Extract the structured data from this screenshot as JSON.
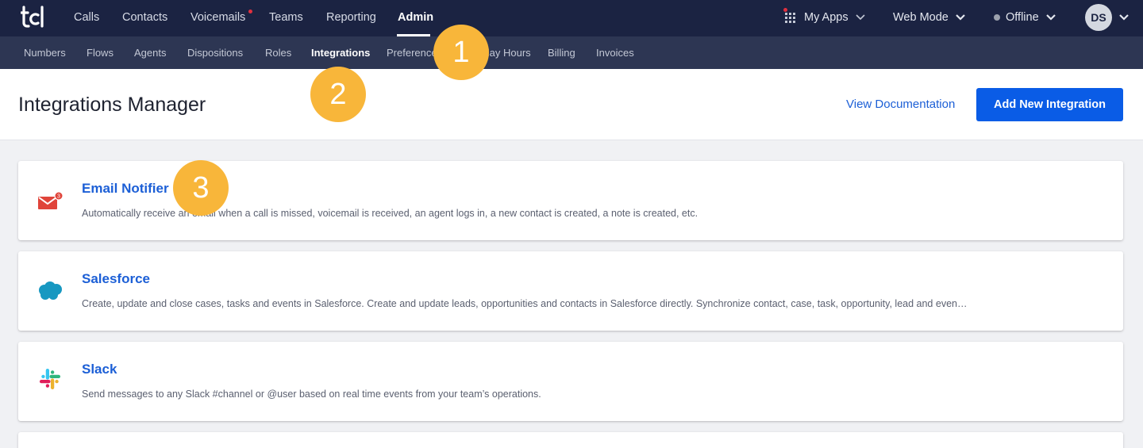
{
  "logo": "tcl",
  "top_nav": {
    "items": [
      {
        "label": "Calls"
      },
      {
        "label": "Contacts"
      },
      {
        "label": "Voicemails"
      },
      {
        "label": "Teams"
      },
      {
        "label": "Reporting"
      },
      {
        "label": "Admin",
        "active": true
      }
    ],
    "right": {
      "my_apps": "My Apps",
      "web_mode": "Web Mode",
      "status": "Offline",
      "avatar_initials": "DS"
    }
  },
  "sub_nav": {
    "items": [
      {
        "label": "Numbers"
      },
      {
        "label": "Flows"
      },
      {
        "label": "Agents"
      },
      {
        "label": "Dispositions"
      },
      {
        "label": "Roles"
      },
      {
        "label": "Integrations",
        "active": true
      },
      {
        "label": "Preferences"
      },
      {
        "label": "Holiday Hours"
      },
      {
        "label": "Billing"
      },
      {
        "label": "Invoices"
      }
    ]
  },
  "header": {
    "title": "Integrations Manager",
    "doc_link": "View Documentation",
    "add_button": "Add New Integration"
  },
  "integrations": [
    {
      "name": "Email Notifier",
      "description": "Automatically receive an email when a call is missed, voicemail is received, an agent logs in, a new contact is created, a note is created, etc.",
      "icon": "email-notifier-icon"
    },
    {
      "name": "Salesforce",
      "description": "Create, update and close cases, tasks and events in Salesforce. Create and update leads, opportunities and contacts in Salesforce directly. Synchronize contact, case, task, opportunity, lead and even…",
      "icon": "salesforce-icon"
    },
    {
      "name": "Slack",
      "description": "Send messages to any Slack #channel or @user based on real time events from your team’s operations.",
      "icon": "slack-icon"
    }
  ],
  "step_badges": [
    "1",
    "2",
    "3"
  ],
  "colors": {
    "topbar": "#1b2342",
    "subbar": "#2d3653",
    "accent_blue": "#0a5ce6",
    "link_blue": "#1c5fd6",
    "badge_orange": "#f8b63a",
    "notification_red": "#e0303f"
  }
}
